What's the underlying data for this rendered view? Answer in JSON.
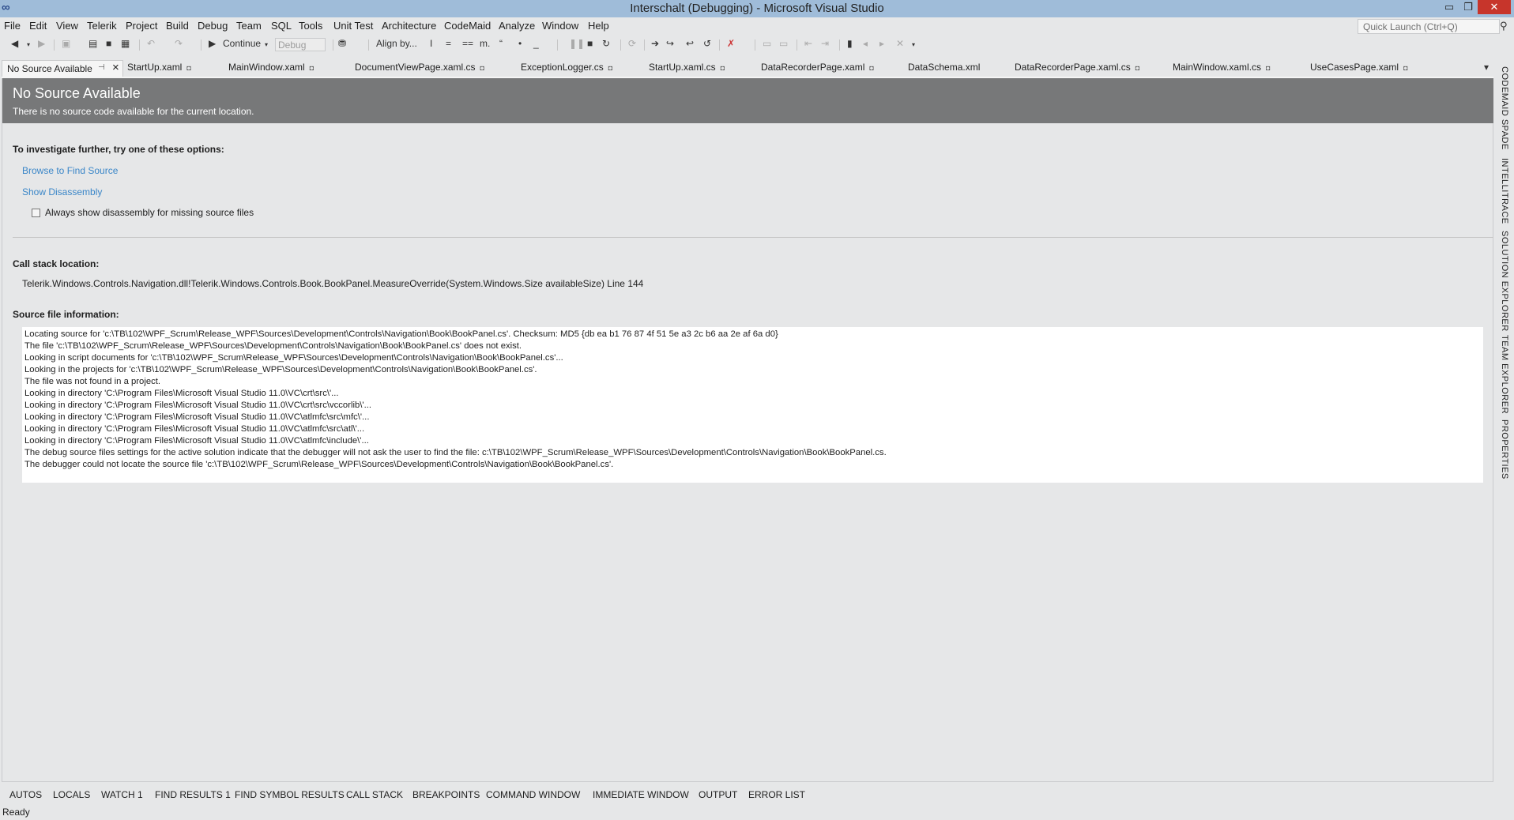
{
  "window": {
    "title": "Interschalt (Debugging) - Microsoft Visual Studio",
    "min": "▭",
    "restore": "❐",
    "close": "✕"
  },
  "menu": [
    "File",
    "Edit",
    "View",
    "Telerik",
    "Project",
    "Build",
    "Debug",
    "Team",
    "SQL",
    "Tools",
    "Unit Test",
    "Architecture",
    "CodeMaid",
    "Analyze",
    "Window",
    "Help"
  ],
  "quick_launch": {
    "placeholder": "Quick Launch (Ctrl+Q)"
  },
  "toolbar": {
    "continue_label": "Continue",
    "config_value": "Debug",
    "align_label": "Align by..."
  },
  "tabs": {
    "active": "No Source Available",
    "others": [
      "StartUp.xaml",
      "MainWindow.xaml",
      "DocumentViewPage.xaml.cs",
      "ExceptionLogger.cs",
      "StartUp.xaml.cs",
      "DataRecorderPage.xaml",
      "DataSchema.xml",
      "DataRecorderPage.xaml.cs",
      "MainWindow.xaml.cs",
      "UseCasesPage.xaml"
    ]
  },
  "page": {
    "title": "No Source Available",
    "subtitle": "There is no source code available for the current location.",
    "investigate_heading": "To investigate further, try one of these options:",
    "browse_link": "Browse to Find Source",
    "disassembly_link": "Show Disassembly",
    "checkbox_label": "Always show disassembly for missing source files",
    "callstack_heading": "Call stack location:",
    "callstack_value": "Telerik.Windows.Controls.Navigation.dll!Telerik.Windows.Controls.Book.BookPanel.MeasureOverride(System.Windows.Size availableSize) Line 144",
    "source_heading": "Source file information:",
    "log": [
      "Locating source for 'c:\\TB\\102\\WPF_Scrum\\Release_WPF\\Sources\\Development\\Controls\\Navigation\\Book\\BookPanel.cs'. Checksum: MD5 {db ea b1 76 87 4f 51 5e a3 2c b6 aa 2e af 6a d0}",
      "The file 'c:\\TB\\102\\WPF_Scrum\\Release_WPF\\Sources\\Development\\Controls\\Navigation\\Book\\BookPanel.cs' does not exist.",
      "Looking in script documents for 'c:\\TB\\102\\WPF_Scrum\\Release_WPF\\Sources\\Development\\Controls\\Navigation\\Book\\BookPanel.cs'...",
      "Looking in the projects for 'c:\\TB\\102\\WPF_Scrum\\Release_WPF\\Sources\\Development\\Controls\\Navigation\\Book\\BookPanel.cs'.",
      "The file was not found in a project.",
      "Looking in directory 'C:\\Program Files\\Microsoft Visual Studio 11.0\\VC\\crt\\src\\'...",
      "Looking in directory 'C:\\Program Files\\Microsoft Visual Studio 11.0\\VC\\crt\\src\\vccorlib\\'...",
      "Looking in directory 'C:\\Program Files\\Microsoft Visual Studio 11.0\\VC\\atlmfc\\src\\mfc\\'...",
      "Looking in directory 'C:\\Program Files\\Microsoft Visual Studio 11.0\\VC\\atlmfc\\src\\atl\\'...",
      "Looking in directory 'C:\\Program Files\\Microsoft Visual Studio 11.0\\VC\\atlmfc\\include\\'...",
      "The debug source files settings for the active solution indicate that the debugger will not ask the user to find the file: c:\\TB\\102\\WPF_Scrum\\Release_WPF\\Sources\\Development\\Controls\\Navigation\\Book\\BookPanel.cs.",
      "The debugger could not locate the source file 'c:\\TB\\102\\WPF_Scrum\\Release_WPF\\Sources\\Development\\Controls\\Navigation\\Book\\BookPanel.cs'."
    ]
  },
  "side_rail": [
    "CODEMAID SPADE",
    "INTELLITRACE",
    "SOLUTION EXPLORER",
    "TEAM EXPLORER",
    "PROPERTIES"
  ],
  "bottom_tabs": [
    "AUTOS",
    "LOCALS",
    "WATCH 1",
    "FIND RESULTS 1",
    "FIND SYMBOL RESULTS",
    "CALL STACK",
    "BREAKPOINTS",
    "COMMAND WINDOW",
    "IMMEDIATE WINDOW",
    "OUTPUT",
    "ERROR LIST"
  ],
  "status": "Ready",
  "colors": {
    "accent_link": "#3a86c8",
    "header_bg": "#777879",
    "titlebar": "#9fbcd9",
    "close": "#c7352b"
  }
}
